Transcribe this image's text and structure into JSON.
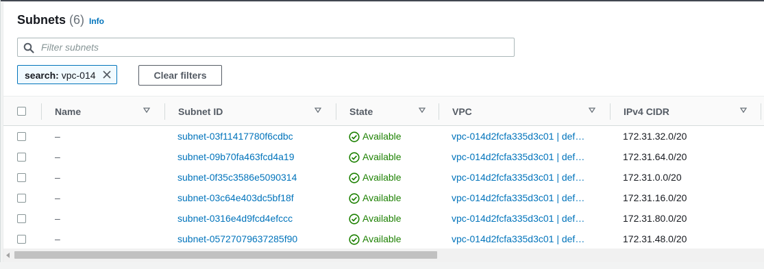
{
  "header": {
    "title": "Subnets",
    "count": "(6)",
    "info_label": "Info"
  },
  "filter": {
    "placeholder": "Filter subnets",
    "value": "",
    "token_key": "search:",
    "token_value": "vpc-014",
    "clear_label": "Clear filters"
  },
  "columns": [
    {
      "label": "Name"
    },
    {
      "label": "Subnet ID"
    },
    {
      "label": "State"
    },
    {
      "label": "VPC"
    },
    {
      "label": "IPv4 CIDR"
    }
  ],
  "rows": [
    {
      "name": "–",
      "subnet_id": "subnet-03f11417780f6cdbc",
      "state": "Available",
      "vpc": "vpc-014d2fcfa335d3c01 | def…",
      "cidr": "172.31.32.0/20"
    },
    {
      "name": "–",
      "subnet_id": "subnet-09b70fa463fcd4a19",
      "state": "Available",
      "vpc": "vpc-014d2fcfa335d3c01 | def…",
      "cidr": "172.31.64.0/20"
    },
    {
      "name": "–",
      "subnet_id": "subnet-0f35c3586e5090314",
      "state": "Available",
      "vpc": "vpc-014d2fcfa335d3c01 | def…",
      "cidr": "172.31.0.0/20"
    },
    {
      "name": "–",
      "subnet_id": "subnet-03c64e403dc5bf18f",
      "state": "Available",
      "vpc": "vpc-014d2fcfa335d3c01 | def…",
      "cidr": "172.31.16.0/20"
    },
    {
      "name": "–",
      "subnet_id": "subnet-0316e4d9fcd4efccc",
      "state": "Available",
      "vpc": "vpc-014d2fcfa335d3c01 | def…",
      "cidr": "172.31.80.0/20"
    },
    {
      "name": "–",
      "subnet_id": "subnet-05727079637285f90",
      "state": "Available",
      "vpc": "vpc-014d2fcfa335d3c01 | def…",
      "cidr": "172.31.48.0/20"
    }
  ],
  "colors": {
    "link": "#0073bb",
    "success": "#1d8102",
    "header_bg": "#fafafa"
  },
  "icons": {
    "search": "search-icon",
    "token_close": "close-icon",
    "sort": "sort-caret-down-icon",
    "state": "check-circle-icon",
    "scroll_left": "scroll-left-arrow-icon"
  }
}
